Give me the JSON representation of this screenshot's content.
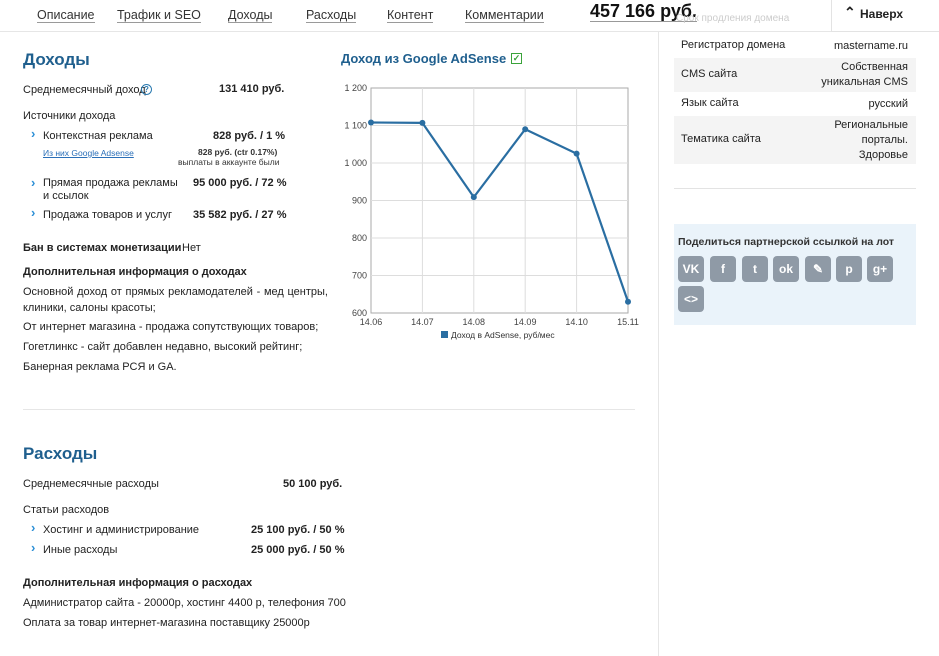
{
  "nav": {
    "items": [
      "Описание",
      "Трафик и SEO",
      "Доходы",
      "Расходы",
      "Контент",
      "Комментарии"
    ],
    "price": "457 166 руб.",
    "faded_text": "Срок продления домена",
    "up_label": "Наверх"
  },
  "income": {
    "title": "Доходы",
    "avg_label": "Среднемесячный доход",
    "avg_value": "131 410 руб.",
    "sources_label": "Источники дохода",
    "sources": [
      {
        "label": "Контекстная реклама",
        "value": "828 руб. / 1 %"
      },
      {
        "label": "Прямая продажа рекламы и ссылок",
        "value": "95 000 руб. / 72 %"
      },
      {
        "label": "Продажа товаров и услуг",
        "value": "35 582 руб. / 27 %"
      }
    ],
    "adsense_link": "Из них Google Adsense",
    "adsense_value": "828 руб. (ctr 0.17%)",
    "adsense_note": "выплаты в аккаунте были",
    "ban_label": "Бан в системах монетизации",
    "ban_value": "Нет",
    "extra_title": "Дополнительная информация о доходах",
    "extra_lines": [
      "Основной доход от прямых рекламодателей - мед центры, клиники, салоны красоты;",
      "От интернет магазина - продажа сопутствующих товаров;",
      "Гогетлинкс - сайт добавлен недавно, высокий рейтинг;",
      "Банерная реклама РСЯ и GA."
    ]
  },
  "chart_title": "Доход из Google AdSense",
  "chart_data": {
    "type": "line",
    "x": [
      "14.06",
      "14.07",
      "14.08",
      "14.09",
      "14.10",
      "15.11"
    ],
    "series": [
      {
        "name": "Доход в AdSense, руб/мес",
        "values": [
          1108,
          1107,
          909,
          1090,
          1025,
          630
        ]
      }
    ],
    "ylim": [
      600,
      1200
    ],
    "yticks": [
      "600",
      "700",
      "800",
      "900",
      "1 000",
      "1 100",
      "1 200"
    ],
    "legend_position": "bottom",
    "grid": true,
    "color": "#2a6ea2"
  },
  "expenses": {
    "title": "Расходы",
    "avg_label": "Среднемесячные расходы",
    "avg_value": "50 100 руб.",
    "items_label": "Статьи расходов",
    "items": [
      {
        "label": "Хостинг и администрирование",
        "value": "25 100 руб. / 50 %"
      },
      {
        "label": "Иные расходы",
        "value": "25 000 руб. / 50 %"
      }
    ],
    "extra_title": "Дополнительная информация о расходах",
    "extra_lines": [
      "Администратор сайта - 20000р, хостинг 4400 р, телефония 700",
      "Оплата за товар интернет-магазина поставщику 25000р"
    ]
  },
  "site_info": [
    {
      "key": "Регистратор домена",
      "value": "mastername.ru"
    },
    {
      "key": "CMS сайта",
      "value": "Собственная уникальная CMS"
    },
    {
      "key": "Язык сайта",
      "value": "русский"
    },
    {
      "key": "Тематика сайта",
      "value": "Региональные порталы. Здоровье"
    }
  ],
  "share": {
    "title": "Поделиться партнерской ссылкой на лот",
    "buttons": [
      "VK",
      "f",
      "t",
      "ok",
      "✎",
      "p",
      "g+",
      "<>"
    ]
  }
}
